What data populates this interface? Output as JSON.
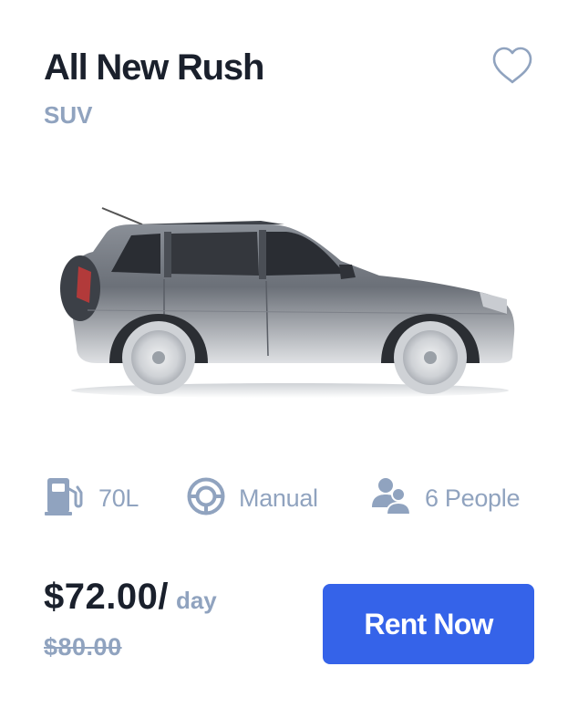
{
  "car": {
    "name": "All New Rush",
    "category": "SUV",
    "image_icon": "suv-car-image",
    "favorite_icon": "heart-outline-icon"
  },
  "specs": [
    {
      "icon": "gas-station-icon",
      "label": "70L"
    },
    {
      "icon": "steering-wheel-icon",
      "label": "Manual"
    },
    {
      "icon": "people-icon",
      "label": "6 People"
    }
  ],
  "pricing": {
    "price": "$72.00/",
    "period": "day",
    "original_price": "$80.00"
  },
  "action": {
    "rent_label": "Rent Now"
  },
  "colors": {
    "primary": "#3563E9",
    "text_dark": "#1A202C",
    "text_muted": "#90A3BF",
    "background": "#FFFFFF"
  }
}
